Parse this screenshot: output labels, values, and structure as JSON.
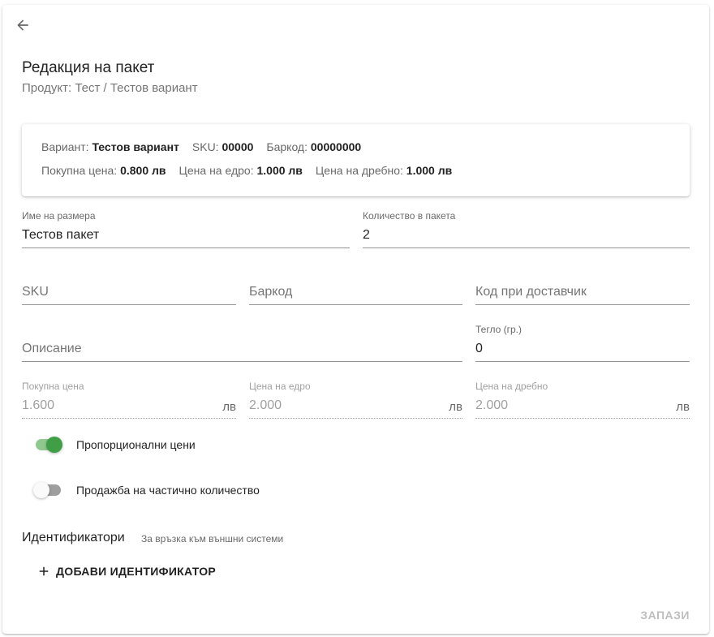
{
  "header": {
    "title": "Редакция на пакет",
    "subtitle": "Продукт: Тест / Тестов вариант"
  },
  "info": {
    "variant_label": "Вариант:",
    "variant_value": "Тестов вариант",
    "sku_label": "SKU:",
    "sku_value": "00000",
    "barcode_label": "Баркод:",
    "barcode_value": "00000000",
    "purchase_label": "Покупна цена:",
    "purchase_value": "0.800 лв",
    "wholesale_label": "Цена на едро:",
    "wholesale_value": "1.000 лв",
    "retail_label": "Цена на дребно:",
    "retail_value": "1.000 лв"
  },
  "form": {
    "size_name": {
      "label": "Име на размера",
      "value": "Тестов пакет"
    },
    "quantity": {
      "label": "Количество в пакета",
      "value": "2"
    },
    "sku": {
      "placeholder": "SKU"
    },
    "barcode": {
      "placeholder": "Баркод"
    },
    "supplier_code": {
      "placeholder": "Код при доставчик"
    },
    "description": {
      "placeholder": "Описание"
    },
    "weight": {
      "label": "Тегло (гр.)",
      "value": "0"
    },
    "purchase_price": {
      "label": "Покупна цена",
      "value": "1.600",
      "suffix": "лв"
    },
    "wholesale_price": {
      "label": "Цена на едро",
      "value": "2.000",
      "suffix": "лв"
    },
    "retail_price": {
      "label": "Цена на дребно",
      "value": "2.000",
      "suffix": "лв"
    }
  },
  "switches": {
    "proportional": {
      "label": "Пропорционални цени",
      "on": true
    },
    "partial_qty": {
      "label": "Продажба на частично количество",
      "on": false
    }
  },
  "identifiers": {
    "title": "Идентификатори",
    "hint": "За връзка към външни системи",
    "add_label": "ДОБАВИ ИДЕНТИФИКАТОР"
  },
  "actions": {
    "save_label": "ЗАПАЗИ"
  },
  "colors": {
    "switch_on": "#3f9e46",
    "switch_on_track": "#8fc98f"
  },
  "icons": {
    "back": "arrow-left-icon",
    "add": "plus-icon"
  }
}
